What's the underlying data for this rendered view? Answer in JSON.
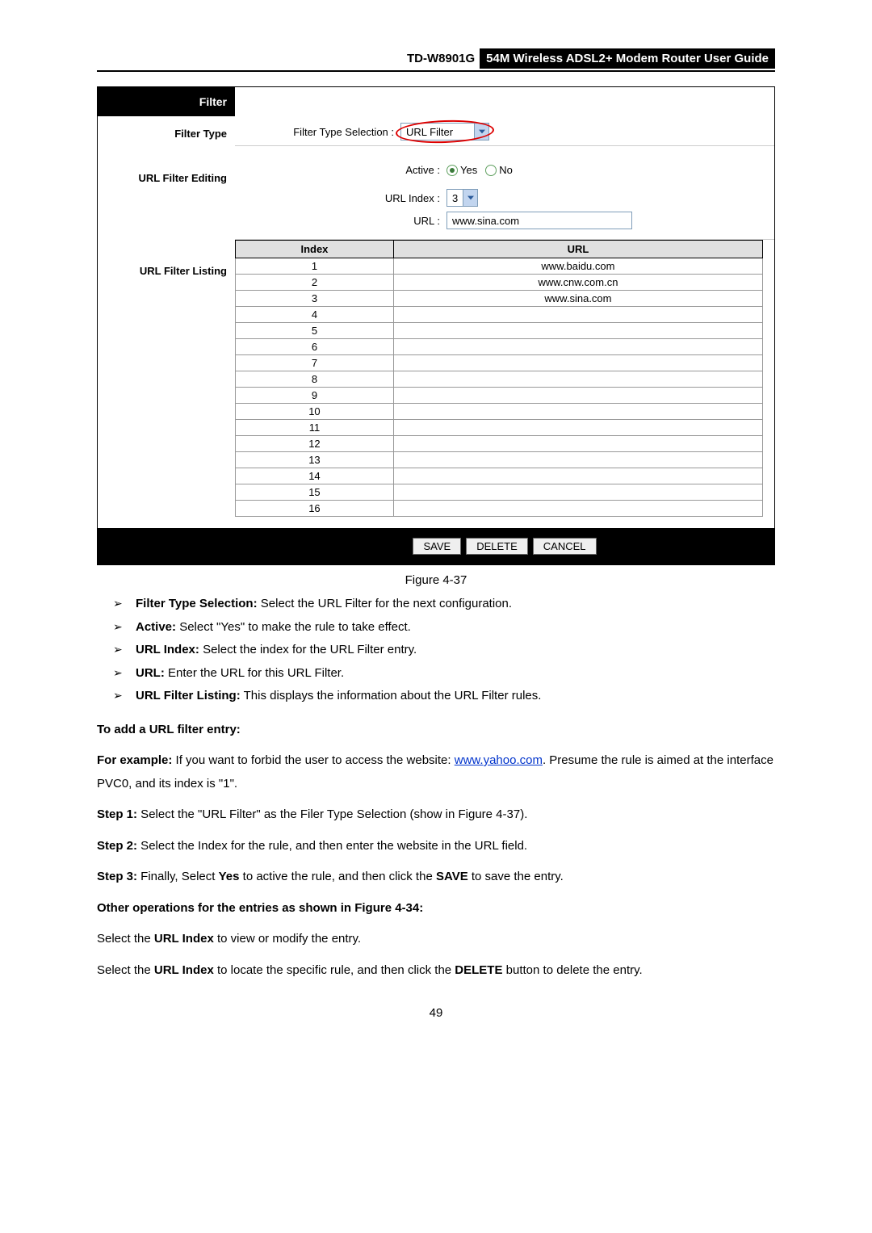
{
  "header": {
    "model": "TD-W8901G",
    "title": "54M Wireless ADSL2+ Modem Router User Guide"
  },
  "panel": {
    "sidebar": {
      "filter": "Filter",
      "filter_type": "Filter Type",
      "url_filter_editing": "URL Filter Editing",
      "url_filter_listing": "URL Filter Listing"
    },
    "filter_type_label": "Filter Type Selection :",
    "filter_type_value": "URL Filter",
    "active_label": "Active :",
    "active_yes": "Yes",
    "active_no": "No",
    "url_index_label": "URL Index :",
    "url_index_value": "3",
    "url_label": "URL :",
    "url_value": "www.sina.com",
    "table": {
      "head_index": "Index",
      "head_url": "URL",
      "rows": [
        {
          "index": "1",
          "url": "www.baidu.com"
        },
        {
          "index": "2",
          "url": "www.cnw.com.cn"
        },
        {
          "index": "3",
          "url": "www.sina.com"
        },
        {
          "index": "4",
          "url": ""
        },
        {
          "index": "5",
          "url": ""
        },
        {
          "index": "6",
          "url": ""
        },
        {
          "index": "7",
          "url": ""
        },
        {
          "index": "8",
          "url": ""
        },
        {
          "index": "9",
          "url": ""
        },
        {
          "index": "10",
          "url": ""
        },
        {
          "index": "11",
          "url": ""
        },
        {
          "index": "12",
          "url": ""
        },
        {
          "index": "13",
          "url": ""
        },
        {
          "index": "14",
          "url": ""
        },
        {
          "index": "15",
          "url": ""
        },
        {
          "index": "16",
          "url": ""
        }
      ]
    },
    "buttons": {
      "save": "SAVE",
      "delete": "DELETE",
      "cancel": "CANCEL"
    }
  },
  "caption": "Figure 4-37",
  "bullets": [
    {
      "b": "Filter Type Selection:",
      "t": " Select the URL Filter for the next configuration."
    },
    {
      "b": "Active:",
      "t": " Select \"Yes\" to make the rule to take effect."
    },
    {
      "b": "URL Index:",
      "t": " Select the index for the URL Filter entry."
    },
    {
      "b": "URL:",
      "t": " Enter the URL for this URL Filter."
    },
    {
      "b": "URL Filter Listing:",
      "t": " This displays the information about the URL Filter rules."
    }
  ],
  "section1_title": "To add a URL filter entry:",
  "example_prefix": "For example:",
  "example_t1": " If you want to forbid the user to access the website: ",
  "example_link": "www.yahoo.com",
  "example_t2": ". Presume the rule is aimed at the interface PVC0, and its index is \"1\".",
  "steps": [
    {
      "b": "Step 1:",
      "t": "  Select the \"URL Filter\" as the Filer Type Selection (show in Figure 4-37)."
    },
    {
      "b": "Step 2:",
      "t": "  Select the Index for the rule, and then enter the website in the URL field."
    }
  ],
  "step3_b": "Step 3:",
  "step3_t1": "  Finally, Select ",
  "step3_yes": "Yes",
  "step3_t2": " to active the rule, and then click the ",
  "step3_save": "SAVE",
  "step3_t3": " to save the entry.",
  "section2_title": "Other operations for the entries as shown in Figure 4-34:",
  "other_t1a": "Select the ",
  "other_t1b": "URL Index",
  "other_t1c": " to view or modify the entry.",
  "other_t2a": "Select the ",
  "other_t2b": "URL Index",
  "other_t2c": " to locate the specific rule, and then click the ",
  "other_t2d": "DELETE",
  "other_t2e": " button to delete the entry.",
  "pagenum": "49"
}
